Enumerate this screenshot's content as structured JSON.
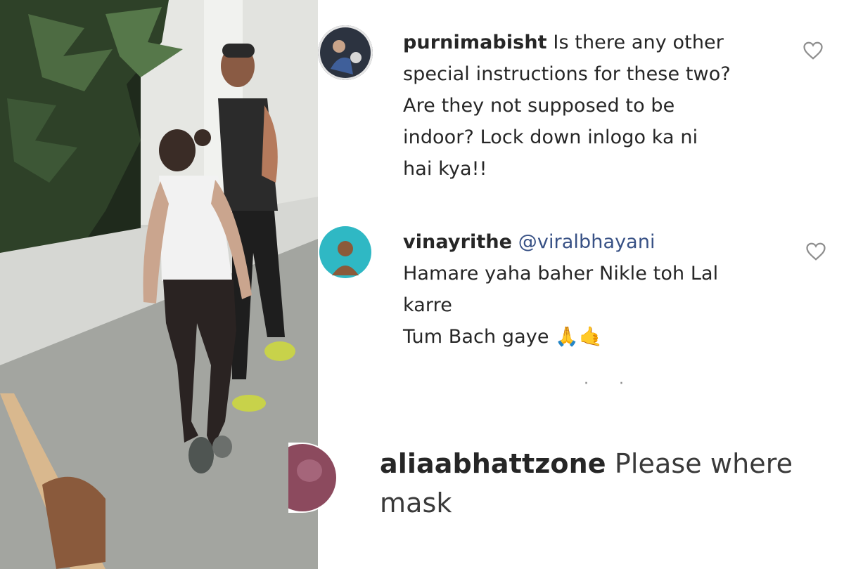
{
  "comments": [
    {
      "username": "purnimabisht",
      "lines": [
        "Is there any other",
        "special instructions for these two?",
        "Are they not supposed to be",
        "indoor? Lock down inlogo ka ni",
        "hai kya!!"
      ],
      "avatar": "profile-photo",
      "like_icon": "heart-icon"
    },
    {
      "username": "vinayrithe",
      "mention": "@viralbhayani",
      "lines": [
        "Hamare yaha baher Nikle toh Lal",
        "karre",
        "Tum Bach gaye"
      ],
      "emojis": [
        "🙏",
        "🤙"
      ],
      "avatar": "profile-photo",
      "like_icon": "heart-icon"
    },
    {
      "username": "aliaabhattzone",
      "lines": [
        "Please where",
        "mask"
      ],
      "avatar": "profile-photo"
    }
  ],
  "colors": {
    "text": "#262626",
    "mention": "#385185",
    "icon": "#8e8e8e"
  }
}
